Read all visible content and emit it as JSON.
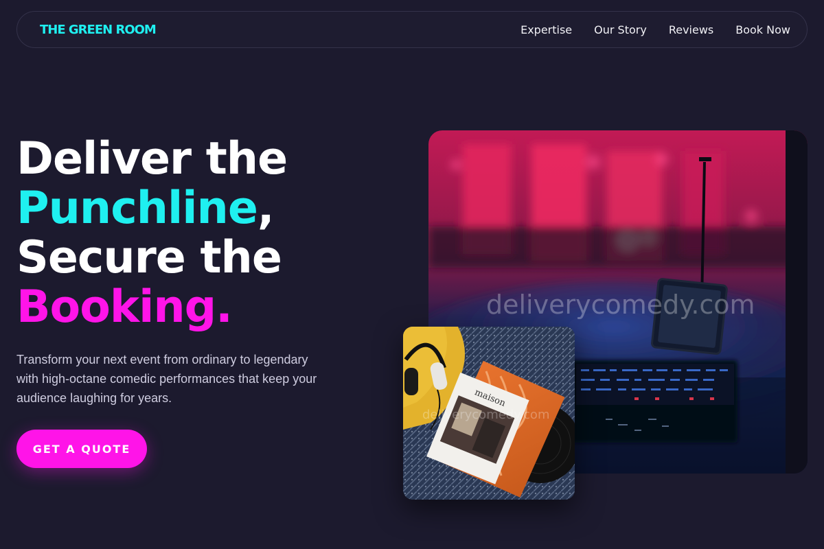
{
  "brand": {
    "name": "THE GREEN ROOM"
  },
  "nav": {
    "links": [
      {
        "label": "Expertise"
      },
      {
        "label": "Our Story"
      },
      {
        "label": "Reviews"
      },
      {
        "label": "Book Now"
      }
    ]
  },
  "hero": {
    "line1": "Deliver the",
    "line2_highlight": "Punchline",
    "line2_suffix": ",",
    "line3": "Secure the",
    "line4_highlight": "Booking.",
    "subtitle": "Transform your next event from ordinary to legendary with high-octane comedic performances that keep your audience laughing for years.",
    "cta_label": "GET A QUOTE"
  },
  "images": {
    "main_watermark": "deliverycomedy.com",
    "small_watermark": "deliverycomedy.com",
    "magazine_title": "maison"
  },
  "colors": {
    "background": "#1c1a2e",
    "accent_cyan": "#1ff0f0",
    "accent_magenta": "#ff14e8"
  }
}
